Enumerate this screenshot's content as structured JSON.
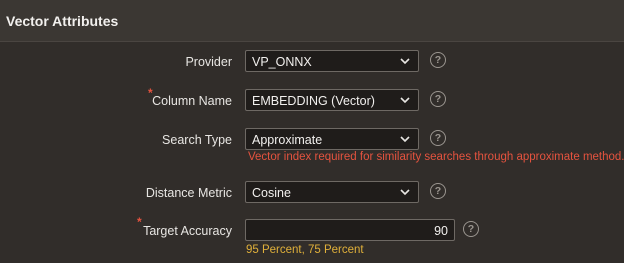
{
  "panel": {
    "title": "Vector Attributes"
  },
  "fields": {
    "provider": {
      "label": "Provider",
      "value": "VP_ONNX"
    },
    "column_name": {
      "label": "Column Name",
      "value": "EMBEDDING (Vector)",
      "required_mark": "*"
    },
    "search_type": {
      "label": "Search Type",
      "value": "Approximate",
      "message": "Vector index required for similarity searches through approximate method."
    },
    "distance_metric": {
      "label": "Distance Metric",
      "value": "Cosine"
    },
    "target_accuracy": {
      "label": "Target Accuracy",
      "value": "90",
      "required_mark": "*",
      "hint": "95 Percent, 75 Percent"
    }
  },
  "help_glyph": "?",
  "colors": {
    "error": "#e5533f",
    "hint": "#e0b03a",
    "background": "#312d2a"
  }
}
